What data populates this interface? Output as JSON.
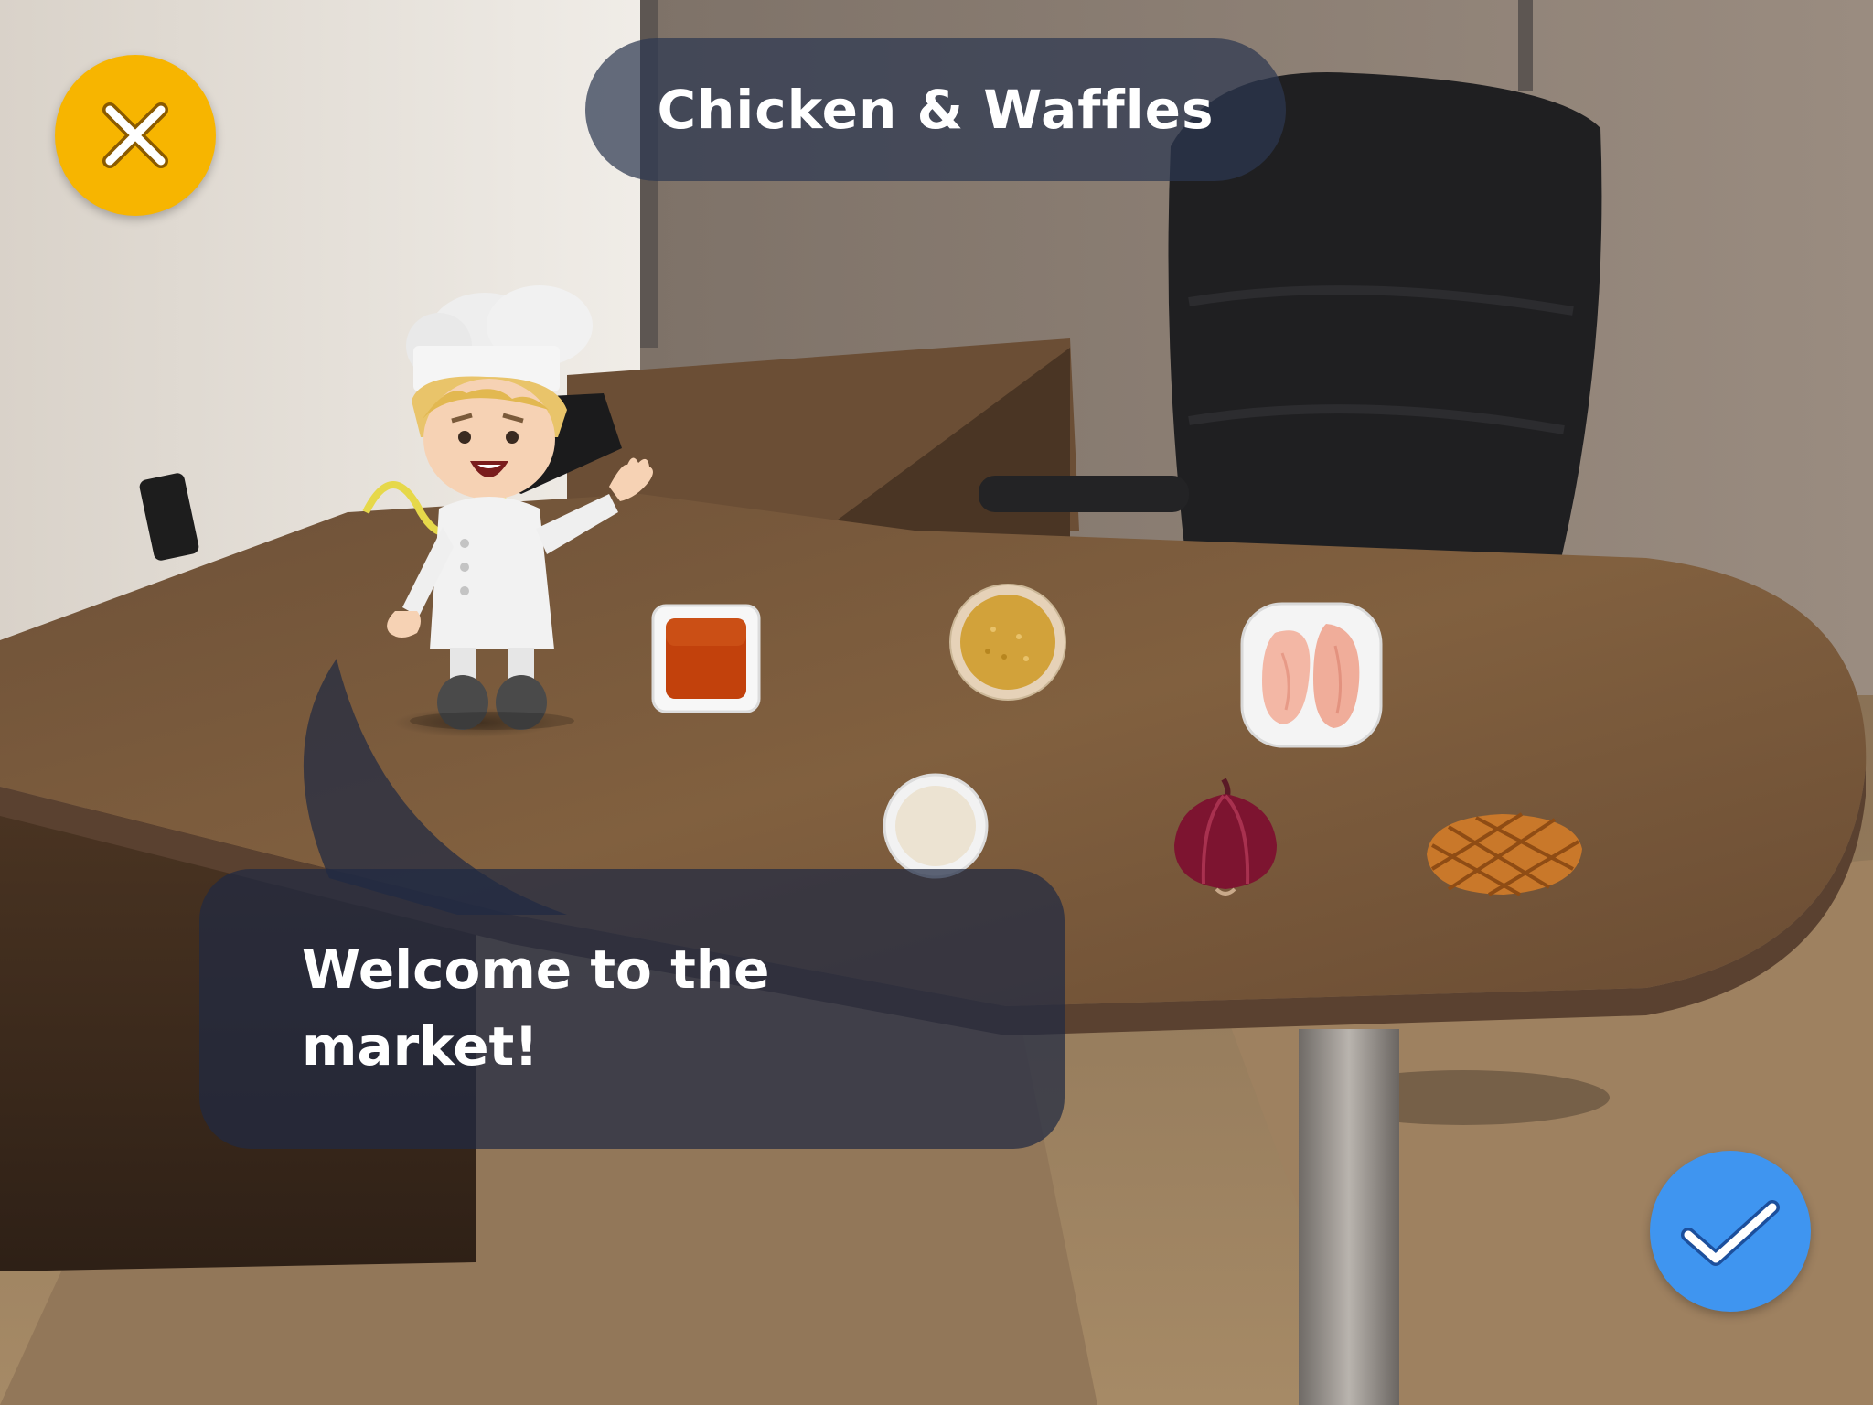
{
  "header": {
    "title": "Chicken & Waffles"
  },
  "controls": {
    "close_icon": "close-x-icon",
    "confirm_icon": "checkmark-icon",
    "close_color": "#f7b500",
    "confirm_color": "#3f95f0"
  },
  "dialog": {
    "message": "Welcome to the market!"
  },
  "ingredients": [
    {
      "id": "syrup",
      "icon": "syrup-dish-icon"
    },
    {
      "id": "breadcrumbs",
      "icon": "breadcrumb-bowl-icon"
    },
    {
      "id": "chicken-breast",
      "icon": "chicken-breast-plate-icon"
    },
    {
      "id": "milk",
      "icon": "milk-bowl-icon"
    },
    {
      "id": "red-onion",
      "icon": "red-onion-icon"
    },
    {
      "id": "waffle",
      "icon": "waffle-icon"
    }
  ]
}
